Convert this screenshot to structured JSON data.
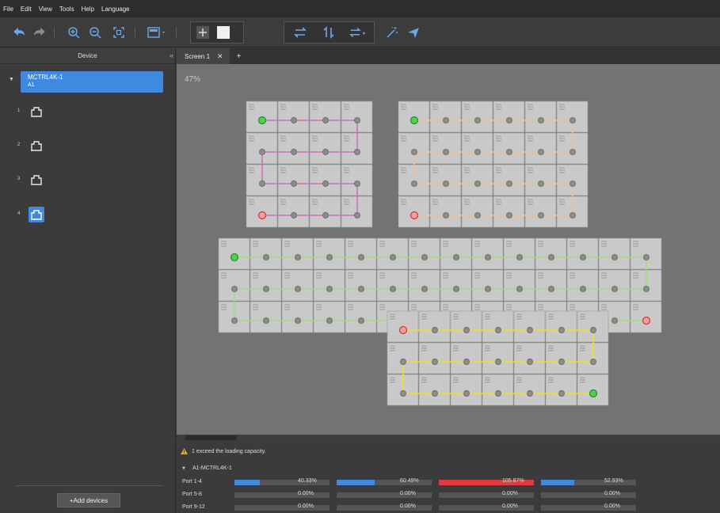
{
  "menu": [
    "File",
    "Edit",
    "View",
    "Tools",
    "Help",
    "Language"
  ],
  "sidebar": {
    "title": "Device",
    "controller": {
      "name": "MCTRL4K-1",
      "id": "A1"
    },
    "ports": [
      {
        "num": "1",
        "color": "#e8e8e8"
      },
      {
        "num": "2",
        "color": "#e8e8e8"
      },
      {
        "num": "3",
        "color": "#e8e8e8"
      },
      {
        "num": "4",
        "color": "#3f8ae0"
      }
    ],
    "add_devices": "+Add devices"
  },
  "tabs": [
    {
      "label": "Screen 1"
    }
  ],
  "canvas": {
    "zoom": "47%"
  },
  "status": {
    "warning": "1 exceed the loading capacity.",
    "controller_label": "A1-MCTRL4K-1",
    "rows": [
      {
        "label": "Port 1-4",
        "values": [
          {
            "pct": "40.33%",
            "fill": 0.2689,
            "color": "#3f8ae0"
          },
          {
            "pct": "60.49%",
            "fill": 0.4033,
            "color": "#3f8ae0"
          },
          {
            "pct": "105.87%",
            "fill": 1.0,
            "color": "#e0393e"
          },
          {
            "pct": "52.93%",
            "fill": 0.3529,
            "color": "#3f8ae0"
          }
        ]
      },
      {
        "label": "Port 5-8",
        "values": [
          {
            "pct": "0.00%",
            "fill": 0,
            "color": "#3f8ae0"
          },
          {
            "pct": "0.00%",
            "fill": 0,
            "color": "#3f8ae0"
          },
          {
            "pct": "0.00%",
            "fill": 0,
            "color": "#3f8ae0"
          },
          {
            "pct": "0.00%",
            "fill": 0,
            "color": "#3f8ae0"
          }
        ]
      },
      {
        "label": "Port 9-12",
        "values": [
          {
            "pct": "0.00%",
            "fill": 0,
            "color": "#3f8ae0"
          },
          {
            "pct": "0.00%",
            "fill": 0,
            "color": "#3f8ae0"
          },
          {
            "pct": "0.00%",
            "fill": 0,
            "color": "#3f8ae0"
          },
          {
            "pct": "0.00%",
            "fill": 0,
            "color": "#3f8ae0"
          }
        ]
      }
    ]
  },
  "screens": [
    {
      "name": "port-1-cabinets",
      "cols": 4,
      "rows": 4,
      "color": "#d070c0",
      "start": "top-left",
      "end": "bottom-left",
      "path": "serpentine-rows"
    },
    {
      "name": "port-2-cabinets",
      "cols": 6,
      "rows": 4,
      "color": "#f0c090",
      "start": "top-left",
      "end": "bottom-left",
      "path": "serpentine-rows"
    },
    {
      "name": "port-3-cabinets",
      "cols": 14,
      "rows": 3,
      "color": "#a0e080",
      "start": "top-left",
      "end": "bottom-right",
      "path": "serpentine-rows"
    },
    {
      "name": "port-4-cabinets",
      "cols": 7,
      "rows": 3,
      "color": "#f0e020",
      "start": "top-left",
      "end": "bottom-right",
      "path": "serpentine-rows-reverse"
    }
  ],
  "colors": {
    "selection": "#3f8ae0",
    "overload": "#e0393e",
    "cabinet": "#c9c9c9",
    "start_dot": "#50d050",
    "end_dot": "#e03030"
  },
  "icons": [
    "undo-icon",
    "redo-icon",
    "zoom-in-icon",
    "zoom-out-icon",
    "fit-icon",
    "layout-icon",
    "add-icon",
    "swap-h-icon",
    "swap-v-icon",
    "swap-icon",
    "magic-icon",
    "send-icon",
    "warning-icon",
    "ethernet-port-icon"
  ]
}
